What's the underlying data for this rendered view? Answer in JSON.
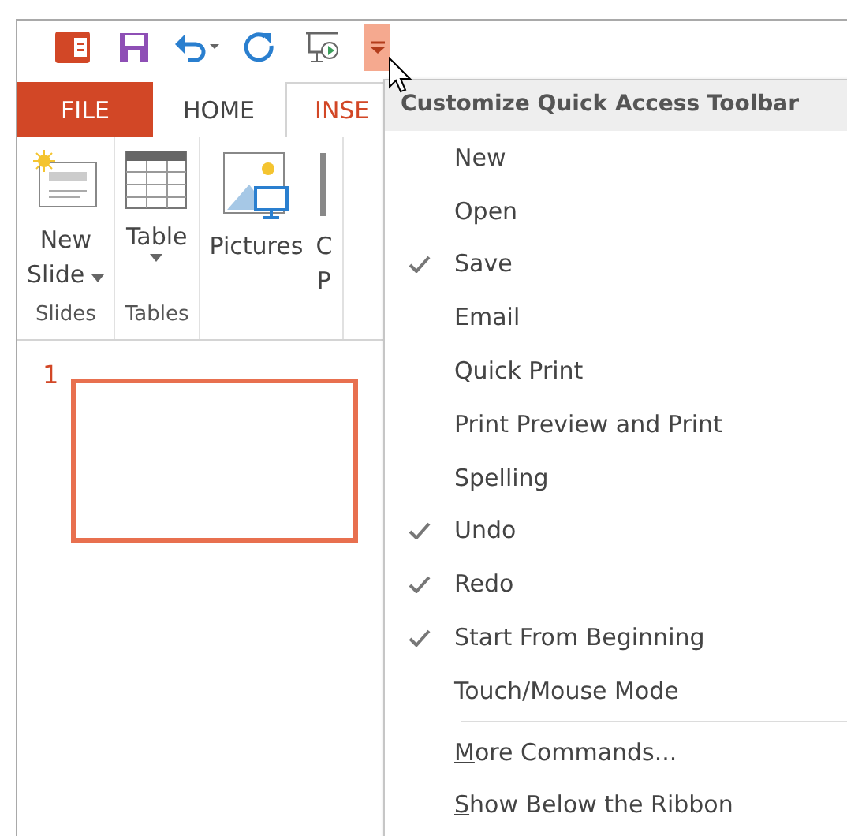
{
  "quick_access_toolbar": {
    "customize_button": {
      "selected": true
    }
  },
  "tabs": [
    {
      "label": "FILE",
      "kind": "file",
      "selected": false
    },
    {
      "label": "HOME",
      "kind": "tab",
      "selected": false
    },
    {
      "label": "INSE",
      "kind": "tab",
      "selected": true
    }
  ],
  "ribbon_groups": [
    {
      "label": "Slides",
      "buttons": [
        {
          "kind": "new-slide",
          "lines": [
            "New",
            "Slide"
          ],
          "dropdown": true
        }
      ]
    },
    {
      "label": "Tables",
      "buttons": [
        {
          "kind": "table",
          "lines": [
            "Table"
          ],
          "dropdown": true
        }
      ]
    },
    {
      "buttons": [
        {
          "kind": "pictures",
          "lines": [
            "Pictures"
          ],
          "dropdown": false
        },
        {
          "kind": "cut",
          "lines": [
            "C",
            "P"
          ],
          "dropdown": false
        }
      ]
    }
  ],
  "slides": [
    {
      "number": "1",
      "selected": true
    }
  ],
  "menu": {
    "title": "Customize Quick Access Toolbar",
    "items": [
      {
        "label": "New",
        "checked": false
      },
      {
        "label": "Open",
        "checked": false
      },
      {
        "label": "Save",
        "checked": true
      },
      {
        "label": "Email",
        "checked": false
      },
      {
        "label": "Quick Print",
        "checked": false
      },
      {
        "label": "Print Preview and Print",
        "checked": false
      },
      {
        "label": "Spelling",
        "checked": false
      },
      {
        "label": "Undo",
        "checked": true
      },
      {
        "label": "Redo",
        "checked": true
      },
      {
        "label": "Start From Beginning",
        "checked": true
      },
      {
        "label": "Touch/Mouse Mode",
        "checked": false
      }
    ],
    "commands": [
      {
        "label": "More Commands...",
        "underline_first": true
      },
      {
        "label": "Show Below the Ribbon",
        "underline_first": true
      }
    ]
  }
}
